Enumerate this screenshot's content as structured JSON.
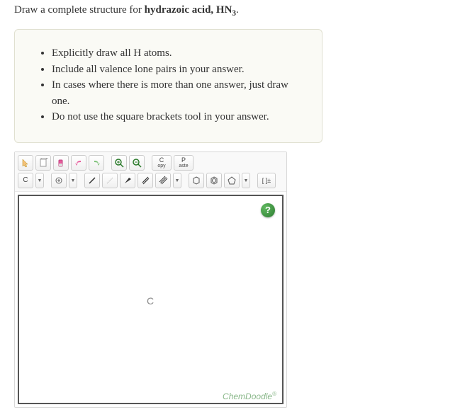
{
  "question": {
    "prefix": "Draw a complete structure for ",
    "compound": "hydrazoic acid, HN",
    "subscript": "3",
    "suffix": "."
  },
  "hints": [
    "Explicitly draw all H atoms.",
    "Include all valence lone pairs in your answer.",
    "In cases where there is more than one answer, just draw one.",
    "Do not use the square brackets tool in your answer."
  ],
  "toolbar": {
    "copy_top": "C",
    "copy_bottom": "opy",
    "paste_top": "P",
    "paste_bottom": "aste",
    "element_label": "C",
    "bracket_label": "[ ]±"
  },
  "canvas": {
    "atom_placeholder": "C",
    "help_label": "?",
    "brand": "ChemDoodle",
    "brand_mark": "®"
  }
}
